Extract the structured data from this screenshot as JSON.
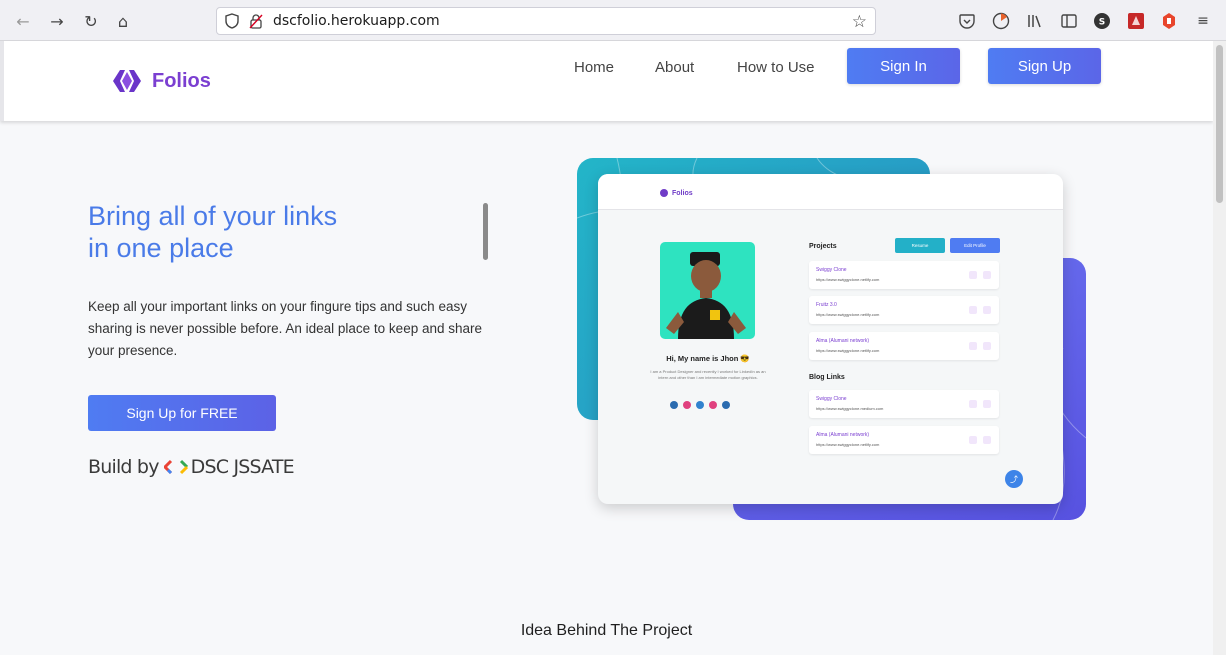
{
  "browser": {
    "url": "dscfolio.herokuapp.com"
  },
  "site": {
    "brand": "Folios",
    "nav": [
      "Home",
      "About",
      "How to Use"
    ],
    "sign_in": "Sign In",
    "sign_up": "Sign Up",
    "accent": "#4f7cf2",
    "brand_color": "#7b3fd1"
  },
  "hero": {
    "title_line1": "Bring all of your links",
    "title_line2": "in one place",
    "description": "Keep all your important links on your fingure tips and such easy sharing is never possible before. An ideal place to keep and share your presence.",
    "cta": "Sign Up for FREE",
    "build_by_prefix": "Build by",
    "build_by_org": "DSC JSSATE"
  },
  "preview": {
    "brand": "Folios",
    "greeting": "Hi, My name is Jhon 😎",
    "bio": "I am a Product Designer and recently I worked for LinkedIn as an intern and other than I am intermediate motion graphics.",
    "projects_title": "Projects",
    "resume_btn": "Resume",
    "edit_btn": "Edit Profile",
    "projects": [
      {
        "title": "Swiggy Clone",
        "url": "https://www.swiggyclone.netlify.com"
      },
      {
        "title": "Fruitz 3.0",
        "url": "https://www.swiggyclone.netlify.com"
      },
      {
        "title": "Alma (Alumani network)",
        "url": "https://www.swiggyclone.netlify.com"
      }
    ],
    "blog_title": "Blog Links",
    "blogs": [
      {
        "title": "Swiggy Clone",
        "url": "https://www.swiggyclone.medium.com"
      },
      {
        "title": "Alma (Alumani network)",
        "url": "https://www.swiggyclone.netlify.com"
      }
    ]
  },
  "sections": {
    "idea_title": "Idea Behind The Project"
  }
}
